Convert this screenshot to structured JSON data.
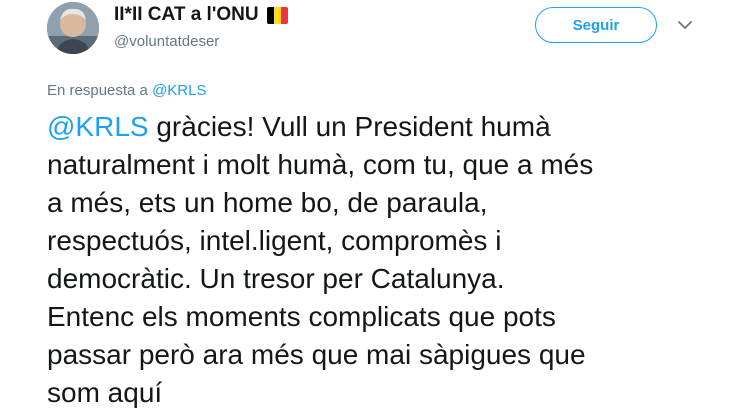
{
  "author": {
    "display_name": "II*II CAT a l'ONU",
    "handle": "@voluntatdeser",
    "avatar_icon": "user-avatar",
    "flag_icon": "belgian-flag-icon",
    "flag_colors": [
      "#000000",
      "#fdda24",
      "#ef3340"
    ]
  },
  "follow_button": {
    "label": "Seguir"
  },
  "menu_icon": "chevron-down-icon",
  "reply": {
    "prefix": "En respuesta a ",
    "mention": "@KRLS"
  },
  "tweet": {
    "mention": "@KRLS",
    "line1_rest": " gràcies!  Vull un President humà",
    "lines": [
      "naturalment i molt humà, com tu, que a més",
      "a més, ets un home bo, de paraula,",
      "respectuós, intel.ligent, compromès i",
      "democràtic. Un tresor per Catalunya.",
      "Entenc els moments complicats que pots",
      "passar però ara més que mai sàpigues que",
      "som aquí"
    ]
  },
  "colors": {
    "accent": "#1da1f2",
    "text": "#14171a",
    "secondary_text": "#657786"
  }
}
